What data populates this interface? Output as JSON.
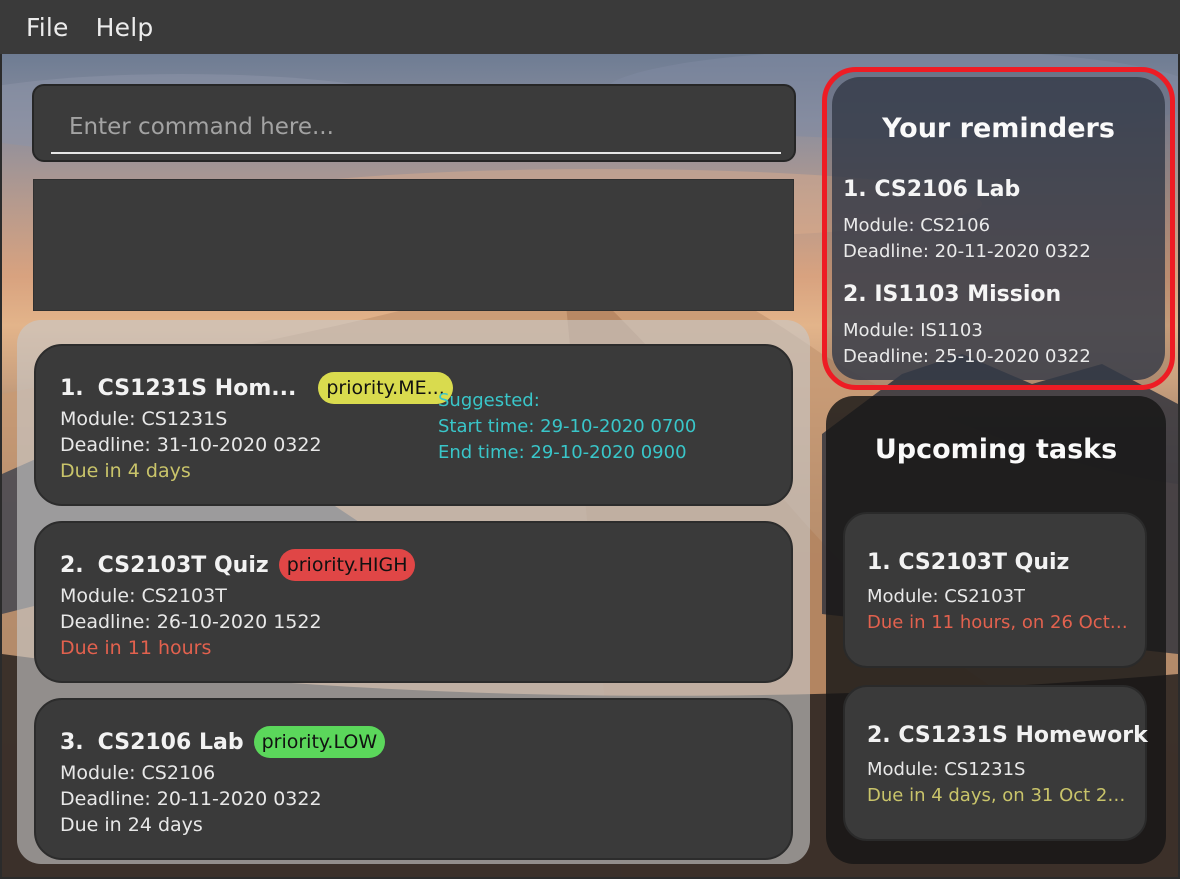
{
  "menu": {
    "file": "File",
    "help": "Help"
  },
  "command": {
    "placeholder": "Enter command here..."
  },
  "tasks": [
    {
      "index": "1.",
      "name": "CS1231S Hom...",
      "priority": "priority.ME...",
      "module": "Module: CS1231S",
      "deadline": "Deadline: 31-10-2020 0322",
      "due": "Due in 4 days",
      "suggested": "Suggested:",
      "start_time": "Start time: 29-10-2020 0700",
      "end_time": "End time: 29-10-2020 0900"
    },
    {
      "index": "2.",
      "name": "CS2103T Quiz",
      "priority": "priority.HIGH",
      "module": "Module: CS2103T",
      "deadline": "Deadline: 26-10-2020 1522",
      "due": "Due in 11 hours"
    },
    {
      "index": "3.",
      "name": "CS2106 Lab",
      "priority": "priority.LOW",
      "module": "Module: CS2106",
      "deadline": "Deadline: 20-11-2020 0322",
      "due": "Due in 24 days"
    }
  ],
  "reminders": {
    "heading": "Your reminders",
    "items": [
      {
        "title": "1.  CS2106 Lab",
        "module": "Module: CS2106",
        "deadline": "Deadline: 20-11-2020 0322"
      },
      {
        "title": "2.  IS1103 Mission",
        "module": "Module: IS1103",
        "deadline": "Deadline: 25-10-2020 0322"
      }
    ]
  },
  "upcoming": {
    "heading": "Upcoming tasks",
    "items": [
      {
        "title": "1.  CS2103T Quiz",
        "module": "Module: CS2103T",
        "due": "Due in 11 hours, on 26 Oct 2..."
      },
      {
        "title": "2.  CS1231S Homework",
        "module": "Module: CS1231S",
        "due": "Due in 4 days, on 31 Oct 202..."
      }
    ]
  },
  "colors": {
    "priority_medium": "#d9db4e",
    "priority_high": "#e04646",
    "priority_low": "#5bd75b",
    "due_soon": "#e2614e",
    "due_medium": "#c9c46a",
    "suggest_text": "#39c6c9",
    "highlight_border": "#ee1c24"
  }
}
